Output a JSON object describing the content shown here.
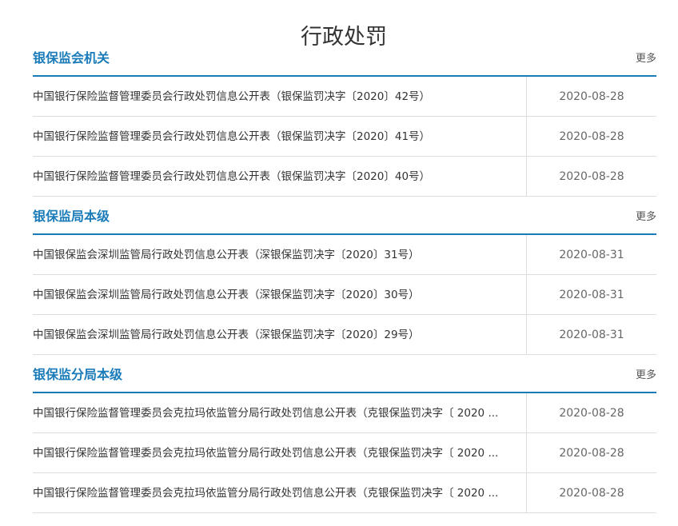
{
  "page": {
    "title": "行政处罚"
  },
  "sections": [
    {
      "title": "银保监会机关",
      "more": "更多",
      "items": [
        {
          "title": "中国银行保险监督管理委员会行政处罚信息公开表（银保监罚决字〔2020〕42号）",
          "date": "2020-08-28"
        },
        {
          "title": "中国银行保险监督管理委员会行政处罚信息公开表（银保监罚决字〔2020〕41号）",
          "date": "2020-08-28"
        },
        {
          "title": "中国银行保险监督管理委员会行政处罚信息公开表（银保监罚决字〔2020〕40号）",
          "date": "2020-08-28"
        }
      ]
    },
    {
      "title": "银保监局本级",
      "more": "更多",
      "items": [
        {
          "title": "中国银保监会深圳监管局行政处罚信息公开表（深银保监罚决字〔2020〕31号）",
          "date": "2020-08-31"
        },
        {
          "title": "中国银保监会深圳监管局行政处罚信息公开表（深银保监罚决字〔2020〕30号）",
          "date": "2020-08-31"
        },
        {
          "title": "中国银保监会深圳监管局行政处罚信息公开表（深银保监罚决字〔2020〕29号）",
          "date": "2020-08-31"
        }
      ]
    },
    {
      "title": "银保监分局本级",
      "more": "更多",
      "items": [
        {
          "title": "中国银行保险监督管理委员会克拉玛依监管分局行政处罚信息公开表（克银保监罚决字〔 2020 ...",
          "date": "2020-08-28"
        },
        {
          "title": "中国银行保险监督管理委员会克拉玛依监管分局行政处罚信息公开表（克银保监罚决字〔 2020 ...",
          "date": "2020-08-28"
        },
        {
          "title": "中国银行保险监督管理委员会克拉玛依监管分局行政处罚信息公开表（克银保监罚决字〔 2020 ...",
          "date": "2020-08-28"
        }
      ]
    }
  ]
}
